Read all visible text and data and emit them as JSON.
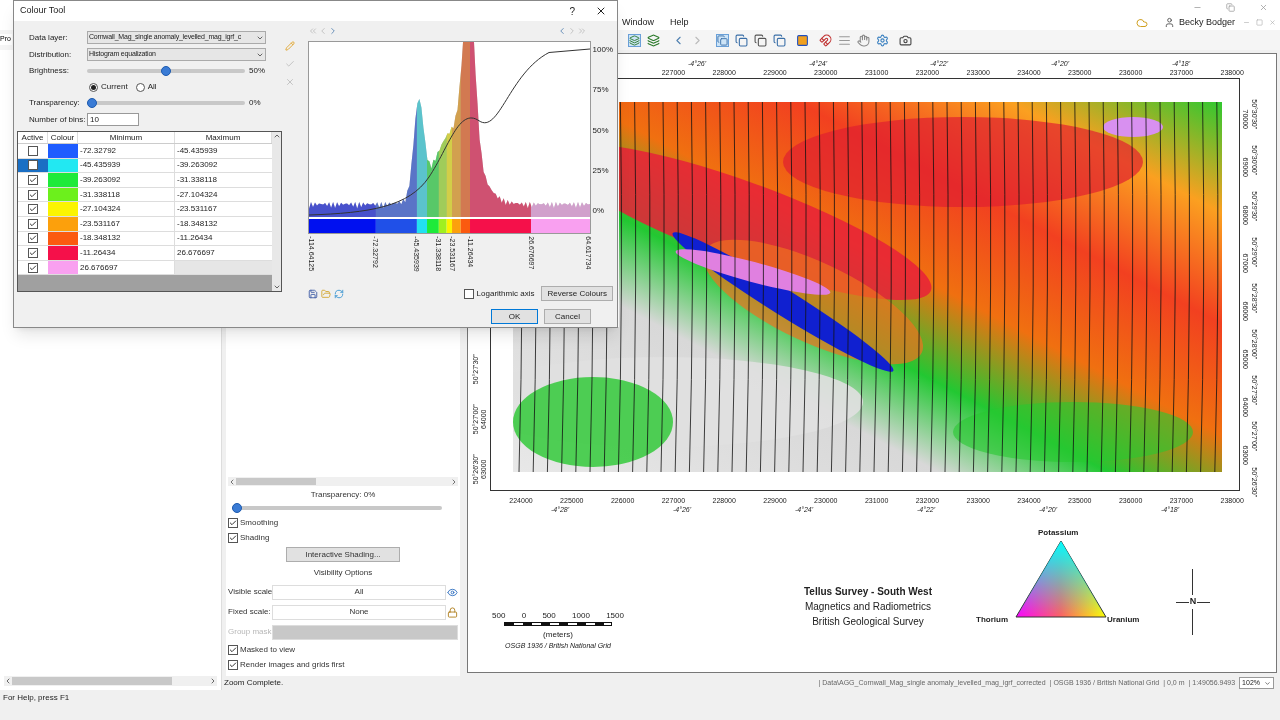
{
  "app": {
    "tab_fragment": "Pro",
    "menu": [
      "Window",
      "Help"
    ],
    "user": "Becky Bodger"
  },
  "dialog": {
    "title": "Colour Tool",
    "help": "?",
    "fields": [
      {
        "label": "Data layer:",
        "value": "Cornwall_Mag_single anomaly_levelled_mag_igrf_c"
      },
      {
        "label": "Distribution:",
        "value": "Histogram equalization"
      }
    ],
    "brightness": {
      "label": "Brightness:",
      "level": 0.5,
      "reading": "50%"
    },
    "scope": [
      {
        "label": "Current",
        "selected": true
      },
      {
        "label": "All",
        "selected": false
      }
    ],
    "transparency": {
      "label": "Transparency:",
      "level": 0,
      "reading": "0%"
    },
    "bins": {
      "label": "Number of bins:",
      "value": "10"
    },
    "table": {
      "columns": [
        "Active",
        "Colour",
        "Minimum",
        "Maximum"
      ],
      "rows": [
        {
          "checked": false,
          "selected": false,
          "color": "#1e5cff",
          "minimum": "-72.32792",
          "maximum": "-45.435939"
        },
        {
          "checked": false,
          "selected": true,
          "color": "#22e8f2",
          "minimum": "-45.435939",
          "maximum": "-39.263092"
        },
        {
          "checked": true,
          "selected": false,
          "color": "#1eea3a",
          "minimum": "-39.263092",
          "maximum": "-31.338118"
        },
        {
          "checked": true,
          "selected": false,
          "color": "#6cf01c",
          "minimum": "-31.338118",
          "maximum": "-27.104324"
        },
        {
          "checked": true,
          "selected": false,
          "color": "#fbf400",
          "minimum": "-27.104324",
          "maximum": "-23.531167"
        },
        {
          "checked": true,
          "selected": false,
          "color": "#fca00c",
          "minimum": "-23.531167",
          "maximum": "-18.348132"
        },
        {
          "checked": true,
          "selected": false,
          "color": "#fb5a10",
          "minimum": "-18.348132",
          "maximum": "-11.26434"
        },
        {
          "checked": true,
          "selected": false,
          "color": "#f5104a",
          "minimum": "-11.26434",
          "maximum": "26.676697"
        },
        {
          "checked": true,
          "selected": false,
          "color": "#f9a0f0",
          "minimum": "26.676697"
        }
      ]
    },
    "histogram": {
      "yticks": [
        "100%",
        "75%",
        "50%",
        "25%",
        "0%"
      ],
      "breaks": [
        "-114.64125",
        "-72.32792",
        "-45.435939",
        "-31.338118",
        "-23.531167",
        "-11.26434",
        "26.676697",
        "64.617734"
      ]
    },
    "log_axis": {
      "label": "Logarithmic axis",
      "checked": false
    },
    "reverse_button": "Reverse Colours",
    "ok": "OK",
    "cancel": "Cancel"
  },
  "layer_properties": {
    "transparency": {
      "label": "Transparency: 0%",
      "level": 0
    },
    "options": [
      {
        "label": "Smoothing",
        "checked": true
      },
      {
        "label": "Shading",
        "checked": true
      }
    ],
    "shading_button": "Interactive Shading...",
    "visibility_heading": "Visibility Options",
    "scales": [
      {
        "label": "Visible scale:",
        "value": "All",
        "disabled": false
      },
      {
        "label": "Fixed scale:",
        "value": "None",
        "disabled": false
      },
      {
        "label": "Group mask:",
        "disabled": true
      }
    ],
    "render_options": [
      {
        "label": "Masked to view",
        "checked": true
      },
      {
        "label": "Render images and grids first",
        "checked": true
      }
    ]
  },
  "map": {
    "top_eastings": [
      "227000",
      "228000",
      "229000",
      "230000",
      "231000",
      "232000",
      "233000",
      "234000",
      "235000",
      "236000",
      "237000",
      "238000"
    ],
    "top_longitudes": [
      "-4°26'",
      "-4°24'",
      "-4°22'",
      "-4°20'",
      "-4°18'"
    ],
    "bottom_eastings": [
      "224000",
      "225000",
      "226000",
      "227000",
      "228000",
      "229000",
      "230000",
      "231000",
      "232000",
      "233000",
      "234000",
      "235000",
      "236000",
      "237000",
      "238000"
    ],
    "bottom_longitudes": [
      "-4°28'",
      "-4°26'",
      "-4°24'",
      "-4°22'",
      "-4°20'",
      "-4°18'"
    ],
    "left_latitudes": [
      "50°27'30\"",
      "50°27'00\"",
      "50°26'30\""
    ],
    "left_northings": [
      "64000",
      "63000"
    ],
    "right_latitudes": [
      "50°30'30\"",
      "50°30'00\"",
      "50°29'30\"",
      "50°29'00\"",
      "50°28'30\"",
      "50°28'00\"",
      "50°27'30\"",
      "50°27'00\"",
      "50°26'30\""
    ],
    "right_northings": [
      "70000",
      "69000",
      "68000",
      "67000",
      "66000",
      "65000",
      "64000",
      "63000"
    ],
    "title": "Tellus Survey - South West",
    "subtitles": [
      "Magnetics and Radiometrics",
      "British Geological Survey"
    ],
    "ternary": [
      "Potassium",
      "Thorium",
      "Uranium"
    ],
    "scale_bar": {
      "ticks": [
        "500",
        "0",
        "500",
        "1000",
        "1500"
      ],
      "unit": "(meters)",
      "projection": "OSGB 1936 / British National Grid"
    },
    "north": "N"
  },
  "status": {
    "message": "Zoom Complete.",
    "help": "For Help, press F1",
    "fields": [
      "| Data\\AGG_Cornwall_Mag_single anomaly_levelled_mag_igrf_corrected",
      "| OSGB 1936 / British National Grid",
      "| 0,0 m",
      "| 1:49056.9493"
    ],
    "zoom": "102%"
  }
}
